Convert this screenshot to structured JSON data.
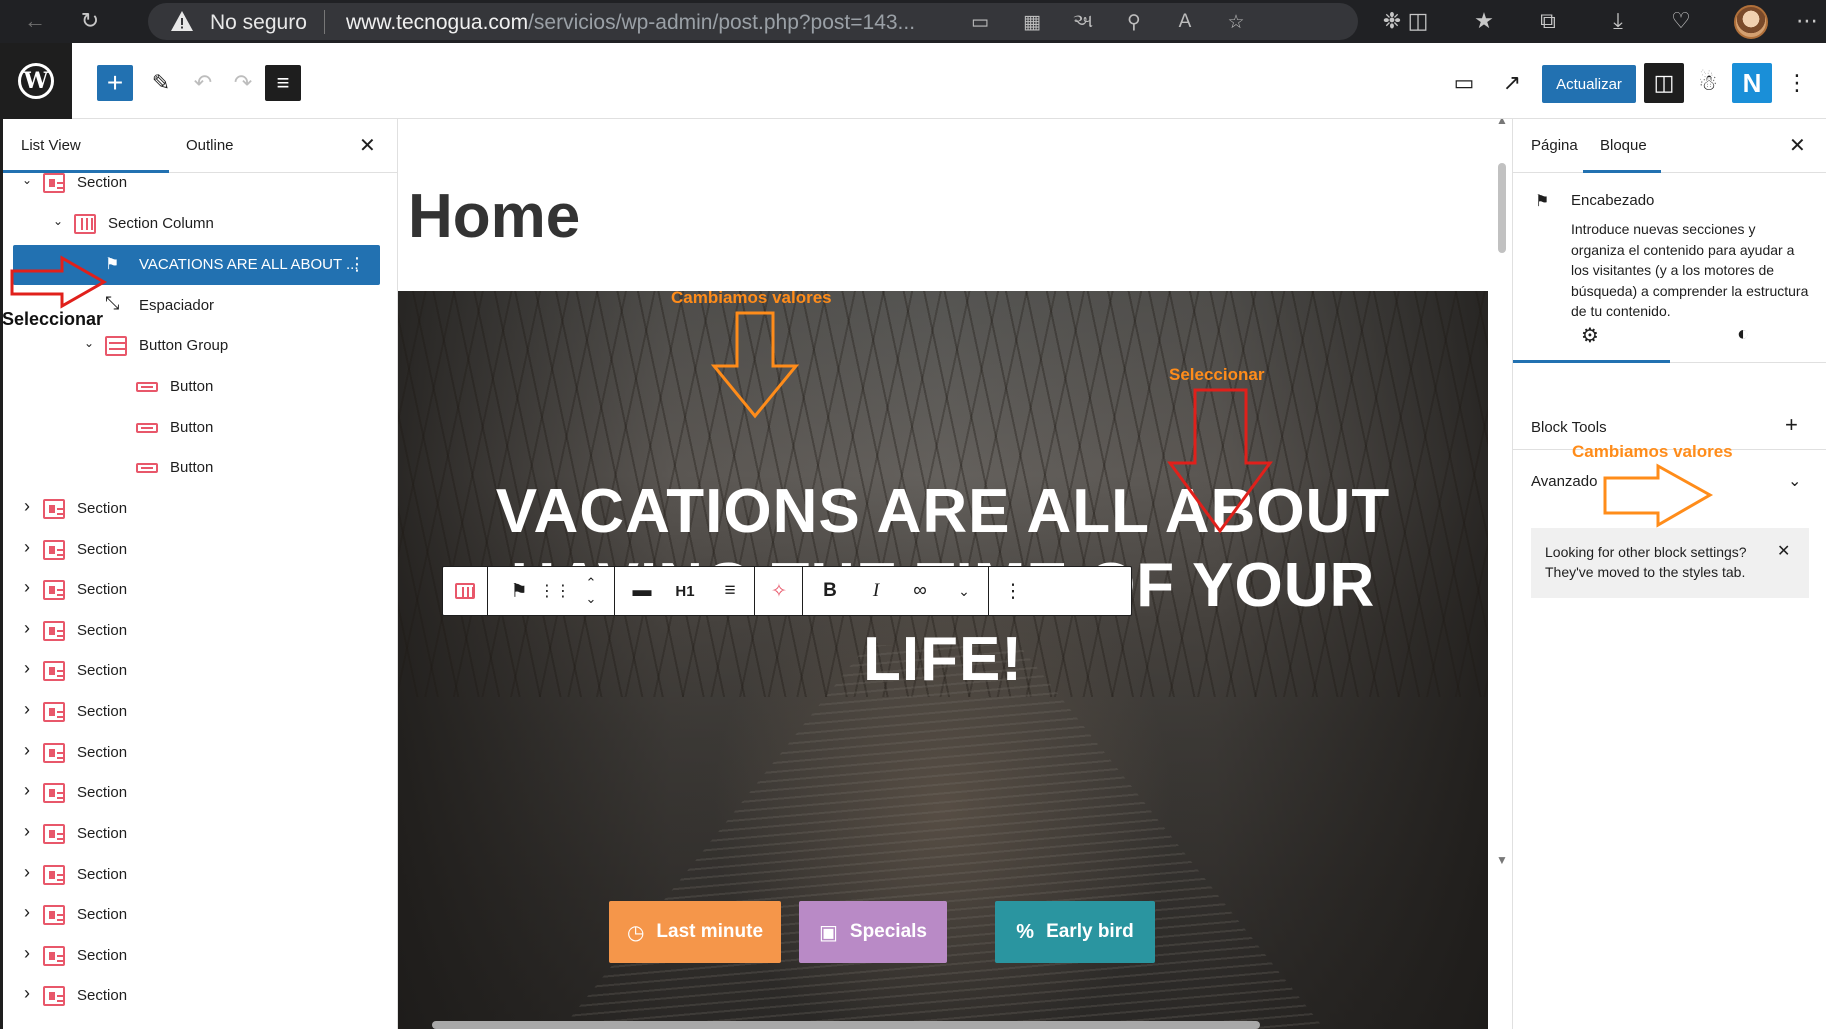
{
  "browser": {
    "security_label": "No seguro",
    "url_domain": "www.tecnogua.com",
    "url_path": "/servicios/wp-admin/post.php?post=143..."
  },
  "toolbar": {
    "update_label": "Actualizar",
    "n_label": "N"
  },
  "list_view": {
    "tab_list": "List View",
    "tab_outline": "Outline",
    "items": [
      {
        "label": "Section",
        "type": "section",
        "expanded": true
      },
      {
        "label": "Section Column",
        "type": "column",
        "expanded": true
      },
      {
        "label": "VACATIONS ARE ALL ABOUT ...",
        "type": "heading",
        "selected": true
      },
      {
        "label": "Espaciador",
        "type": "spacer"
      },
      {
        "label": "Button Group",
        "type": "group",
        "expanded": true
      },
      {
        "label": "Button",
        "type": "button"
      },
      {
        "label": "Button",
        "type": "button"
      },
      {
        "label": "Button",
        "type": "button"
      },
      {
        "label": "Section",
        "type": "section"
      },
      {
        "label": "Section",
        "type": "section"
      },
      {
        "label": "Section",
        "type": "section"
      },
      {
        "label": "Section",
        "type": "section"
      },
      {
        "label": "Section",
        "type": "section"
      },
      {
        "label": "Section",
        "type": "section"
      },
      {
        "label": "Section",
        "type": "section"
      },
      {
        "label": "Section",
        "type": "section"
      },
      {
        "label": "Section",
        "type": "section"
      },
      {
        "label": "Section",
        "type": "section"
      },
      {
        "label": "Section",
        "type": "section"
      },
      {
        "label": "Section",
        "type": "section"
      },
      {
        "label": "Section",
        "type": "section"
      }
    ]
  },
  "editor": {
    "page_title": "Home",
    "hero_heading": "VACATIONS ARE ALL ABOUT HAVING THE TIME OF YOUR LIFE!",
    "block_toolbar": {
      "heading_level": "H1",
      "bold": "B",
      "italic": "I"
    },
    "buttons": [
      {
        "label": "Last minute",
        "icon": "clock-icon",
        "color": "#f5964a"
      },
      {
        "label": "Specials",
        "icon": "gift-icon",
        "color": "#b98ac6"
      },
      {
        "label": "Early bird",
        "icon": "percent-icon",
        "color": "#2a95a0"
      }
    ]
  },
  "inspector": {
    "tab_page": "Página",
    "tab_block": "Bloque",
    "block_name": "Encabezado",
    "block_description": "Introduce nuevas secciones y organiza el contenido para ayudar a los visitantes (y a los motores de búsqueda) a comprender la estructura de tu contenido.",
    "block_tools": "Block Tools",
    "advanced": "Avanzado",
    "notice": "Looking for other block settings? They've moved to the styles tab."
  },
  "annotations": {
    "seleccionar_left": "Seleccionar",
    "cambiamos_top": "Cambiamos valores",
    "seleccionar_hero": "Seleccionar",
    "cambiamos_right": "Cambiamos valores"
  },
  "colors": {
    "wp_blue": "#2271b1",
    "annotation_orange": "#ff8c1a",
    "annotation_red": "#e0201b",
    "block_icon_pink": "#e8576a"
  }
}
